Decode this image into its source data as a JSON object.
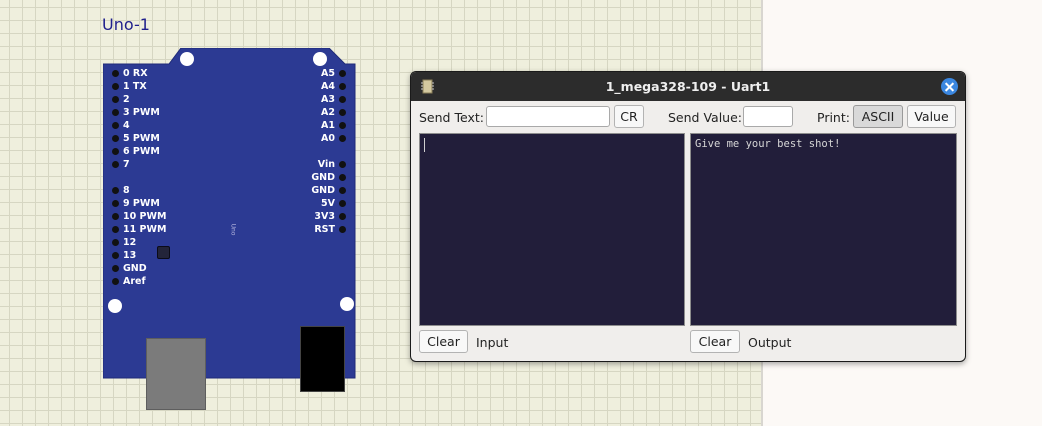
{
  "canvas": {
    "component_label": "Uno-1"
  },
  "board": {
    "left_pins": [
      {
        "num": "0",
        "label": "RX"
      },
      {
        "num": "1",
        "label": "TX"
      },
      {
        "num": "2",
        "label": ""
      },
      {
        "num": "3",
        "label": "PWM"
      },
      {
        "num": "4",
        "label": ""
      },
      {
        "num": "5",
        "label": "PWM"
      },
      {
        "num": "6",
        "label": "PWM"
      },
      {
        "num": "7",
        "label": ""
      },
      {
        "num": "8",
        "label": ""
      },
      {
        "num": "9",
        "label": "PWM"
      },
      {
        "num": "10",
        "label": "PWM"
      },
      {
        "num": "11",
        "label": "PWM"
      },
      {
        "num": "12",
        "label": ""
      },
      {
        "num": "13",
        "label": ""
      },
      {
        "num": "GND",
        "label": ""
      },
      {
        "num": "Aref",
        "label": ""
      }
    ],
    "right_pins": [
      "A5",
      "A4",
      "A3",
      "A2",
      "A1",
      "A0",
      "Vin",
      "GND",
      "GND",
      "5V",
      "3V3",
      "RST"
    ],
    "silk_text": "Uno"
  },
  "uart": {
    "title": "1_mega328-109 - Uart1",
    "send_text_label": "Send Text:",
    "send_text_value": "",
    "cr_label": "CR",
    "send_value_label": "Send Value:",
    "send_value_value": "",
    "print_label": "Print:",
    "ascii_label": "ASCII",
    "value_label": "Value",
    "input_text": "",
    "output_text": "Give me your best shot!",
    "clear_input_label": "Clear",
    "input_label": "Input",
    "clear_output_label": "Clear",
    "output_label": "Output"
  }
}
